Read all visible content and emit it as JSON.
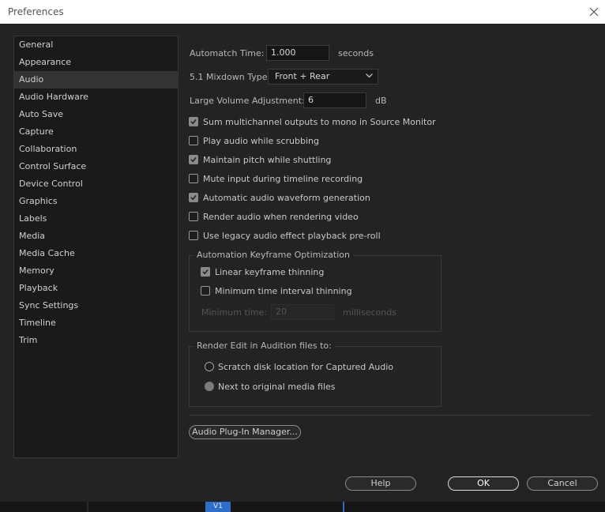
{
  "window": {
    "title": "Preferences"
  },
  "sidebar": {
    "items": [
      {
        "label": "General"
      },
      {
        "label": "Appearance"
      },
      {
        "label": "Audio",
        "active": true
      },
      {
        "label": "Audio Hardware"
      },
      {
        "label": "Auto Save"
      },
      {
        "label": "Capture"
      },
      {
        "label": "Collaboration"
      },
      {
        "label": "Control Surface"
      },
      {
        "label": "Device Control"
      },
      {
        "label": "Graphics"
      },
      {
        "label": "Labels"
      },
      {
        "label": "Media"
      },
      {
        "label": "Media Cache"
      },
      {
        "label": "Memory"
      },
      {
        "label": "Playback"
      },
      {
        "label": "Sync Settings"
      },
      {
        "label": "Timeline"
      },
      {
        "label": "Trim"
      }
    ]
  },
  "audio": {
    "automatch_label": "Automatch Time:",
    "automatch_value": "1.000",
    "automatch_unit": "seconds",
    "mixdown_label": "5.1 Mixdown Type:",
    "mixdown_value": "Front + Rear",
    "volume_label": "Large Volume Adjustment:",
    "volume_value": "6",
    "volume_unit": "dB",
    "checkboxes": [
      {
        "label": "Sum multichannel outputs to mono in Source Monitor",
        "checked": true
      },
      {
        "label": "Play audio while scrubbing",
        "checked": false
      },
      {
        "label": "Maintain pitch while shuttling",
        "checked": true
      },
      {
        "label": "Mute input during timeline recording",
        "checked": false
      },
      {
        "label": "Automatic audio waveform generation",
        "checked": true
      },
      {
        "label": "Render audio when rendering video",
        "checked": false
      },
      {
        "label": "Use legacy audio effect playback pre-roll",
        "checked": false
      }
    ],
    "keyframe_group": {
      "title": "Automation Keyframe Optimization",
      "linear_label": "Linear keyframe thinning",
      "linear_checked": true,
      "min_interval_label": "Minimum time interval thinning",
      "min_interval_checked": false,
      "min_time_label": "Minimum time:",
      "min_time_value": "20",
      "min_time_unit": "milliseconds"
    },
    "render_group": {
      "title": "Render Edit in Audition files to:",
      "options": [
        {
          "label": "Scratch disk location for Captured Audio",
          "selected": false
        },
        {
          "label": "Next to original media files",
          "selected": true
        }
      ]
    },
    "plugin_button": "Audio Plug-In Manager..."
  },
  "buttons": {
    "help": "Help",
    "ok": "OK",
    "cancel": "Cancel"
  },
  "taskbar": {
    "tab_label": "V1"
  },
  "colors": {
    "accent": "#2d6fc8",
    "background": "#232323",
    "sidebar": "#1a1a1a"
  }
}
